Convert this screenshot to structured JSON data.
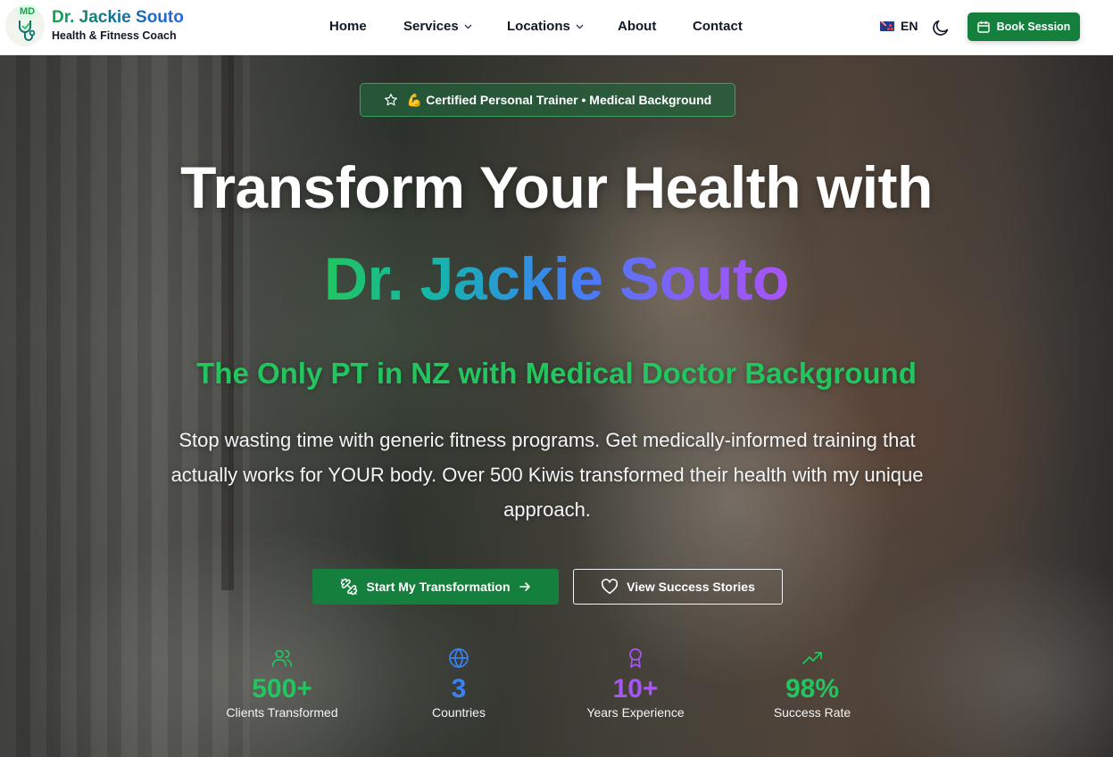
{
  "brand": {
    "badge": "MD",
    "name": "Dr. Jackie Souto",
    "tagline": "Health & Fitness Coach",
    "logo_icon": "stethoscope-icon"
  },
  "nav": {
    "items": [
      {
        "label": "Home",
        "dropdown": false
      },
      {
        "label": "Services",
        "dropdown": true
      },
      {
        "label": "Locations",
        "dropdown": true
      },
      {
        "label": "About",
        "dropdown": false
      },
      {
        "label": "Contact",
        "dropdown": false
      }
    ],
    "language": {
      "label": "EN",
      "flag_icon": "nz-flag-icon"
    },
    "theme_icon": "moon-icon",
    "book_label": "Book Session",
    "book_icon": "calendar-icon"
  },
  "hero": {
    "badge": {
      "icon": "star-icon",
      "emoji": "💪",
      "text": "Certified Personal Trainer • Medical Background"
    },
    "headline": "Transform Your Health with",
    "headline_name": "Dr. Jackie Souto",
    "subheadline": "The Only PT in NZ with Medical Doctor Background",
    "description": "Stop wasting time with generic fitness programs. Get medically-informed training that actually works for YOUR body. Over 500 Kiwis transformed their health with my unique approach.",
    "primary_cta": {
      "label": "Start My Transformation",
      "icon": "dumbbell-icon",
      "trailing_icon": "arrow-right-icon"
    },
    "secondary_cta": {
      "label": "View Success Stories",
      "icon": "heart-icon"
    },
    "stats": [
      {
        "value": "500+",
        "label": "Clients Transformed",
        "icon": "users-icon",
        "color": "#22c55e"
      },
      {
        "value": "3",
        "label": "Countries",
        "icon": "globe-icon",
        "color": "#3b82f6"
      },
      {
        "value": "10+",
        "label": "Years Experience",
        "icon": "award-icon",
        "color": "#a855f7"
      },
      {
        "value": "98%",
        "label": "Success Rate",
        "icon": "trending-up-icon",
        "color": "#22c55e"
      }
    ]
  },
  "colors": {
    "accent_green": "#15803d",
    "bright_green": "#22c55e",
    "blue": "#3b82f6",
    "purple": "#a855f7"
  }
}
